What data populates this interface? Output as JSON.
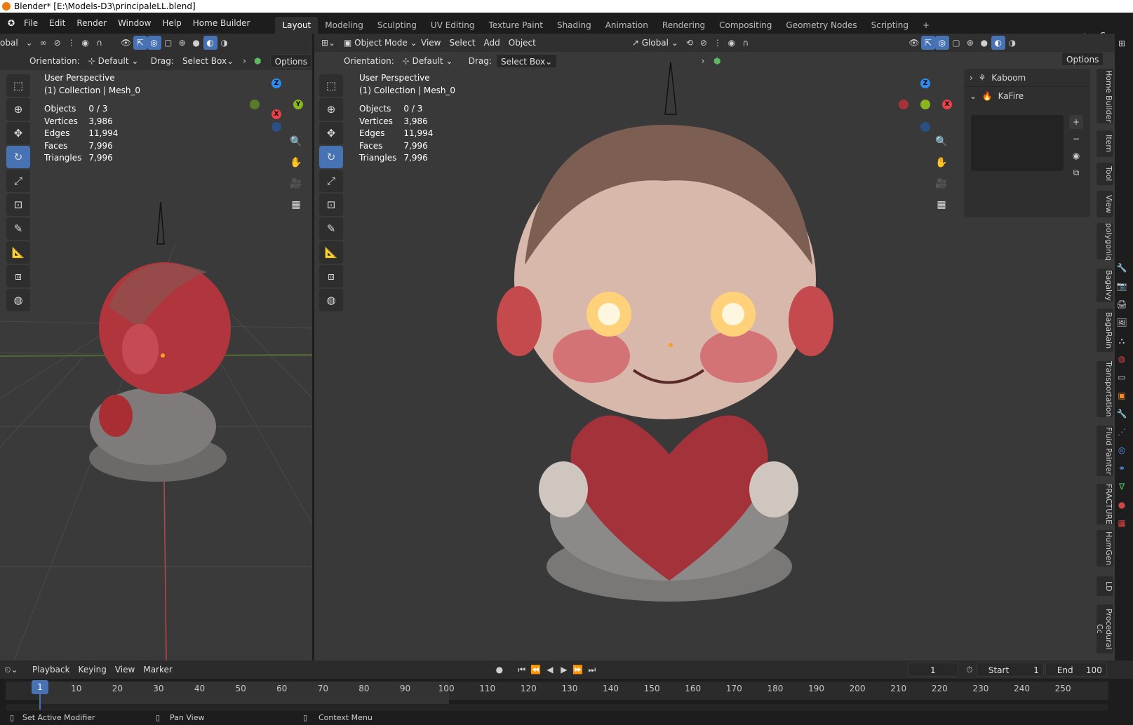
{
  "titlebar": {
    "title": "Blender* [E:\\Models-D3\\principaleLL.blend]"
  },
  "menu": [
    "File",
    "Edit",
    "Render",
    "Window",
    "Help",
    "Home Builder"
  ],
  "workspaces": [
    {
      "label": "Layout",
      "active": true
    },
    {
      "label": "Modeling"
    },
    {
      "label": "Sculpting"
    },
    {
      "label": "UV Editing"
    },
    {
      "label": "Texture Paint"
    },
    {
      "label": "Shading"
    },
    {
      "label": "Animation"
    },
    {
      "label": "Rendering"
    },
    {
      "label": "Compositing"
    },
    {
      "label": "Geometry Nodes"
    },
    {
      "label": "Scripting"
    }
  ],
  "scene": {
    "label": "Scene"
  },
  "left_header": {
    "global_label": "obal"
  },
  "left_tool_header": {
    "orientation_label": "Orientation:",
    "orientation_value": "Default",
    "drag_label": "Drag:",
    "drag_value": "Select Box",
    "options": "Options"
  },
  "right_header": {
    "mode": "Object Mode",
    "view": "View",
    "select": "Select",
    "add": "Add",
    "object": "Object",
    "transform": "Global",
    "options": "Options"
  },
  "right_tool_header": {
    "orientation_label": "Orientation:",
    "orientation_value": "Default",
    "drag_label": "Drag:",
    "drag_value": "Select Box"
  },
  "viewport_info": {
    "perspective": "User Perspective",
    "collection": "(1) Collection | Mesh_0",
    "stats": [
      {
        "label": "Objects",
        "value": "0 / 3"
      },
      {
        "label": "Vertices",
        "value": "3,986"
      },
      {
        "label": "Edges",
        "value": "11,994"
      },
      {
        "label": "Faces",
        "value": "7,996"
      },
      {
        "label": "Triangles",
        "value": "7,996"
      }
    ]
  },
  "gizmo": {
    "x": "X",
    "y": "Y",
    "z": "Z"
  },
  "npanel": {
    "panels": [
      "Kaboom",
      "KaFire"
    ]
  },
  "side_tabs": [
    "Home Builder",
    "Item",
    "Tool",
    "View",
    "polygoniq",
    "Bagalvy",
    "BagaRain",
    "Transportation",
    "Fluid Painter",
    "FRACTURE",
    "HumGen",
    "LD",
    "Procedural Cc"
  ],
  "timeline": {
    "menus": [
      "Playback",
      "Keying",
      "View",
      "Marker"
    ],
    "current_frame": "1",
    "start_label": "Start",
    "start_value": "1",
    "end_label": "End",
    "end_value": "100",
    "ticks": [
      "10",
      "20",
      "30",
      "40",
      "50",
      "60",
      "70",
      "80",
      "90",
      "100",
      "110",
      "120",
      "130",
      "140",
      "150",
      "160",
      "170",
      "180",
      "190",
      "200",
      "210",
      "220",
      "230",
      "240",
      "250"
    ],
    "playhead": "1"
  },
  "status": {
    "left": "Set Active Modifier",
    "middle": "Pan View",
    "right": "Context Menu"
  },
  "colors": {
    "accent": "#4772b3",
    "x_axis": "#e8414a",
    "y_axis": "#8ab51f",
    "z_axis": "#2d8ceb"
  }
}
